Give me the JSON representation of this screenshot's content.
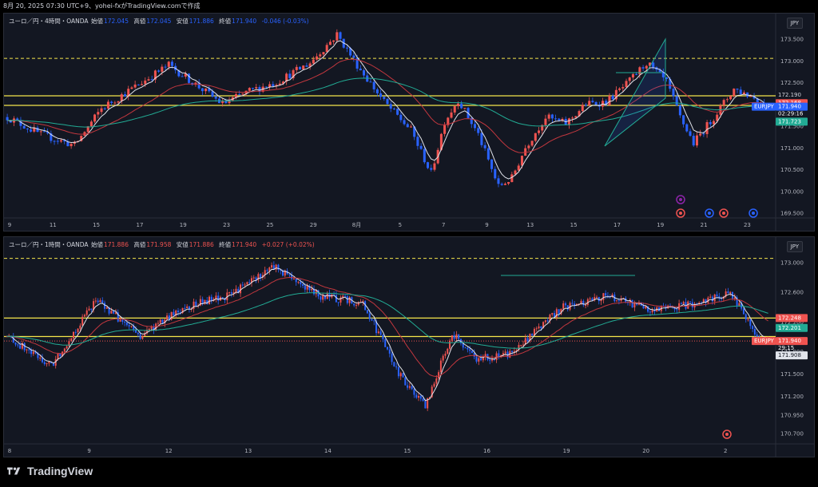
{
  "caption": "8月 20, 2025 07:30 UTC+9、yohei-fxがTradingView.comで作成",
  "currency_button": "JPY",
  "brand": "TradingView",
  "colors": {
    "up": "#ef5350",
    "down": "#2962ff",
    "ma_fast": "#e0e3eb",
    "ma_mid": "#c2373e",
    "ma_slow": "#22ab94",
    "yellow": "#f5e64b",
    "bg": "#131722"
  },
  "panel1": {
    "header": {
      "symbol": "ユーロ／円・4時間・OANDA",
      "open_label": "始値",
      "open": "172.045",
      "high_label": "高値",
      "high": "172.045",
      "low_label": "安値",
      "low": "171.886",
      "close_label": "終値",
      "close": "171.940",
      "change": "-0.046 (-0.03%)"
    },
    "price_axis": [
      "173.500",
      "173.000",
      "172.500",
      "172.000",
      "171.500",
      "171.000",
      "170.500",
      "170.000",
      "169.500"
    ],
    "time_axis": [
      "9",
      "11",
      "15",
      "17",
      "19",
      "23",
      "25",
      "29",
      "8月",
      "5",
      "7",
      "9",
      "13",
      "15",
      "17",
      "19",
      "21",
      "23"
    ],
    "tags": {
      "t1": "172.190",
      "t2": "172.168",
      "symbol": "EURJPY",
      "price": "171.940",
      "countdown": "02:29:16",
      "t3": "171.723"
    }
  },
  "panel2": {
    "header": {
      "symbol": "ユーロ／円・1時間・OANDA",
      "open_label": "始値",
      "open": "171.886",
      "high_label": "高値",
      "high": "171.958",
      "low_label": "安値",
      "low": "171.886",
      "close_label": "終値",
      "close": "171.940",
      "change": "+0.027 (+0.02%)"
    },
    "price_axis": [
      "173.000",
      "172.600",
      "172.200",
      "171.800",
      "171.500",
      "171.200",
      "170.950",
      "170.700"
    ],
    "time_axis": [
      "8",
      "9",
      "12",
      "13",
      "14",
      "15",
      "16",
      "19",
      "20",
      "2"
    ],
    "tags": {
      "t1": "172.248",
      "t2": "172.201",
      "symbol": "EURJPY",
      "price": "171.940",
      "countdown": "29:15",
      "t3": "171.908"
    }
  },
  "chart_data": [
    {
      "type": "candlestick",
      "title": "ユーロ／円・4時間・OANDA",
      "ylim": [
        169.4,
        173.75
      ],
      "x_ticks": [
        "9",
        "11",
        "15",
        "17",
        "19",
        "23",
        "25",
        "29",
        "8月",
        "5",
        "7",
        "9",
        "13",
        "15",
        "17",
        "19",
        "21",
        "23"
      ],
      "anchors": [
        [
          0,
          171.7
        ],
        [
          10,
          171.3
        ],
        [
          20,
          171.05
        ],
        [
          28,
          171.9
        ],
        [
          38,
          172.4
        ],
        [
          48,
          172.9
        ],
        [
          56,
          172.45
        ],
        [
          64,
          172.0
        ],
        [
          72,
          172.3
        ],
        [
          80,
          172.5
        ],
        [
          90,
          172.95
        ],
        [
          98,
          173.6
        ],
        [
          104,
          172.9
        ],
        [
          112,
          172.05
        ],
        [
          120,
          171.4
        ],
        [
          126,
          170.4
        ],
        [
          130,
          171.6
        ],
        [
          134,
          172.1
        ],
        [
          140,
          171.3
        ],
        [
          146,
          170.1
        ],
        [
          150,
          170.3
        ],
        [
          154,
          171.0
        ],
        [
          160,
          171.7
        ],
        [
          166,
          171.55
        ],
        [
          172,
          172.0
        ],
        [
          178,
          172.05
        ],
        [
          184,
          172.45
        ],
        [
          190,
          172.95
        ],
        [
          196,
          172.5
        ],
        [
          200,
          171.7
        ],
        [
          204,
          171.1
        ],
        [
          210,
          171.7
        ],
        [
          216,
          172.35
        ],
        [
          222,
          172.15
        ],
        [
          226,
          171.9
        ]
      ],
      "n": 227,
      "h_lines": [
        {
          "value": 173.05,
          "style": "dashed",
          "color": "yellow"
        },
        {
          "value": 172.19,
          "style": "solid",
          "color": "yellow"
        },
        {
          "value": 171.97,
          "style": "solid",
          "color": "yellow"
        }
      ]
    },
    {
      "type": "candlestick",
      "title": "ユーロ／円・1時間・OANDA",
      "ylim": [
        170.6,
        173.1
      ],
      "x_ticks": [
        "8",
        "9",
        "12",
        "13",
        "14",
        "15",
        "16",
        "19",
        "20",
        "2"
      ],
      "anchors": [
        [
          0,
          172.0
        ],
        [
          20,
          171.6
        ],
        [
          40,
          172.5
        ],
        [
          60,
          172.0
        ],
        [
          80,
          172.4
        ],
        [
          100,
          172.55
        ],
        [
          120,
          172.95
        ],
        [
          140,
          172.55
        ],
        [
          160,
          172.45
        ],
        [
          176,
          171.5
        ],
        [
          188,
          171.05
        ],
        [
          200,
          172.05
        ],
        [
          210,
          171.7
        ],
        [
          225,
          171.75
        ],
        [
          250,
          172.4
        ],
        [
          270,
          172.55
        ],
        [
          290,
          172.35
        ],
        [
          310,
          172.45
        ],
        [
          325,
          172.6
        ],
        [
          336,
          172.05
        ],
        [
          342,
          171.93
        ]
      ],
      "n": 343,
      "h_lines": [
        {
          "value": 173.05,
          "style": "dashed",
          "color": "yellow"
        },
        {
          "value": 172.248,
          "style": "solid",
          "color": "yellow"
        },
        {
          "value": 172.0,
          "style": "solid",
          "color": "yellow"
        },
        {
          "value": 171.94,
          "style": "dotted",
          "color": "red"
        }
      ]
    }
  ]
}
